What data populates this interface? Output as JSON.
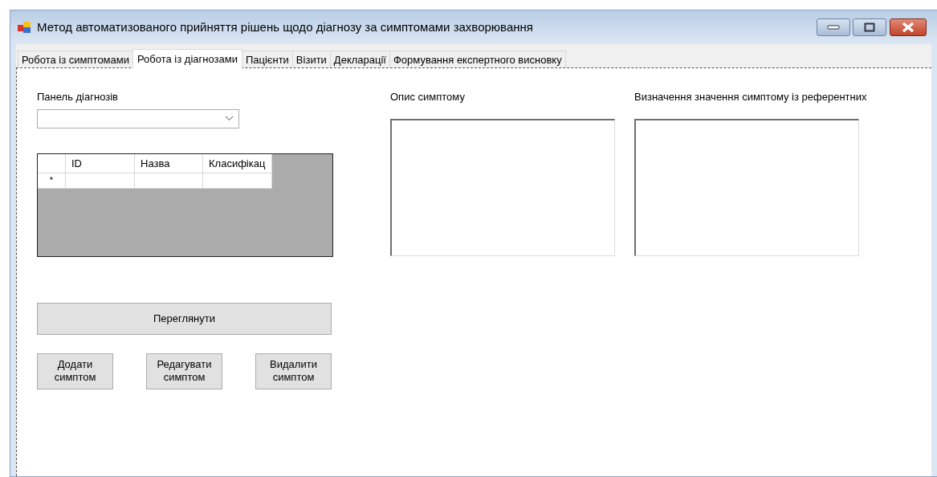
{
  "window": {
    "title": "Метод автоматизованого прийняття рішень щодо діагнозу за симптомами захворювання"
  },
  "tabs": [
    {
      "label": "Робота із симптомами",
      "selected": false
    },
    {
      "label": "Робота із діагнозами",
      "selected": true
    },
    {
      "label": "Пацієнти",
      "selected": false
    },
    {
      "label": "Візити",
      "selected": false
    },
    {
      "label": "Декларації",
      "selected": false
    },
    {
      "label": "Формування експертного висновку",
      "selected": false
    }
  ],
  "diagnosis_panel": {
    "label": "Панель діагнозів"
  },
  "grid": {
    "columns": [
      "ID",
      "Назва",
      "Класифікац"
    ],
    "new_row_marker": "*"
  },
  "view_button": "Переглянути",
  "action_buttons": [
    "Додати симптом",
    "Редагувати симптом",
    "Видалити симптом"
  ],
  "description": {
    "label": "Опис симптому"
  },
  "reference_value": {
    "label": "Визначення значення симптому із референтних"
  }
}
